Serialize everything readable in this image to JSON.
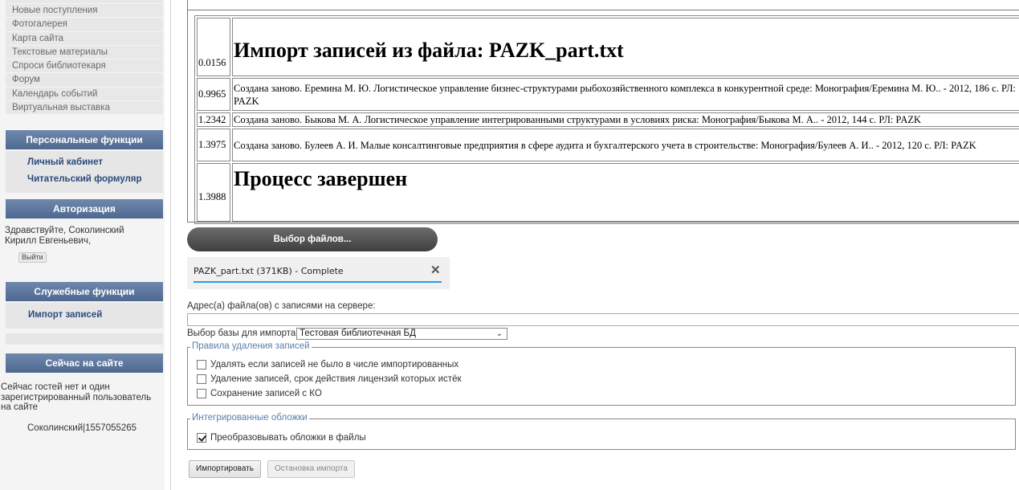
{
  "sidebar": {
    "menu_items": [
      "",
      "Новые поступления",
      "Фотогалерея",
      "Карта сайта",
      "Текстовые материалы",
      "Спроси библиотекаря",
      "Форум",
      "Календарь событий",
      "Виртуальная выставка"
    ],
    "personal": {
      "title": "Персональные функции",
      "links": [
        "Личный кабинет",
        "Читательский формуляр"
      ]
    },
    "auth": {
      "title": "Авторизация",
      "greeting_line1": "Здравствуйте, Соколинский",
      "greeting_line2": "Кирилл Евгеньевич,",
      "logout_label": "Выйти"
    },
    "service": {
      "title": "Служебные функции",
      "links": [
        "Импорт записей"
      ]
    },
    "online": {
      "title": "Сейчас на сайте",
      "line1": "Сейчас гостей нет и один",
      "line2": "зарегистрированный пользователь",
      "line3": "на сайте",
      "user": "Соколинский|1557055265"
    }
  },
  "log": {
    "rows": [
      {
        "time": "0.0156",
        "text": "Импорт записей из файла: PAZK_part.txt"
      },
      {
        "time": "0.9965",
        "text": "Создана заново. Еремина М. Ю. Логистическое управление бизнес-структурами рыбохозяйственного комплекса в конкурентной среде: Монография/Еремина М. Ю.. - 2012, 186 с. РЛ: PAZK"
      },
      {
        "time": "1.2342",
        "text": "Создана заново. Быкова М. А. Логистическое управление интегрированными структурами в условиях риска: Монография/Быкова М. А.. - 2012, 144 с. РЛ: PAZK"
      },
      {
        "time": "1.3975",
        "text": "Создана заново. Булеев А. И. Малые консалтинговые предприятия в сфере аудита и бухгалтерского учета в строительстве: Монография/Булеев А. И.. - 2012, 120 с. РЛ: PAZK"
      },
      {
        "time": "1.3988",
        "text": "Процесс завершен"
      }
    ]
  },
  "upload": {
    "select_button": "Выбор файлов...",
    "file_label": "PAZK_part.txt (371KB) - Complete",
    "progress": 1.0
  },
  "form": {
    "server_label": "Адрес(а) файла(ов) с записями на сервере:",
    "server_value": "",
    "db_label": "Выбор базы для импорта:",
    "db_selected": "Тестовая библиотечная БД",
    "delete_rules": {
      "legend": "Правила удаления записей",
      "options": [
        {
          "label": "Удалять если записей не было в числе импортированных",
          "checked": false
        },
        {
          "label": "Удаление записей, срок действия лицензий которых истёк",
          "checked": false
        },
        {
          "label": "Сохранение записей с КО",
          "checked": false
        }
      ]
    },
    "covers": {
      "legend": "Интегрированные обложки",
      "options": [
        {
          "label": "Преобразовывать обложки в файлы",
          "checked": true
        }
      ]
    },
    "import_button": "Импортировать",
    "stop_button": "Остановка импорта"
  }
}
